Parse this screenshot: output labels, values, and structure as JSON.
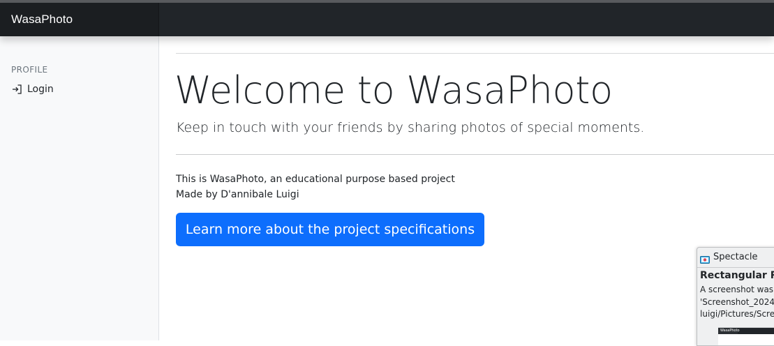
{
  "app": {
    "brand": "WasaPhoto"
  },
  "sidebar": {
    "heading": "PROFILE",
    "items": [
      {
        "label": "Login",
        "icon": "login-icon"
      }
    ]
  },
  "main": {
    "title": "Welcome to WasaPhoto",
    "lead": "Keep in touch with your friends by sharing photos of special moments.",
    "description": [
      "This is WasaPhoto, an educational purpose based project",
      "Made by D'annibale Luigi"
    ],
    "cta_label": "Learn more about the project specifications"
  },
  "notification": {
    "app_name": "Spectacle",
    "title": "Rectangular Re",
    "body_lines": [
      "A screenshot was",
      "'Screenshot_2024",
      "luigi/Pictures/Scre"
    ],
    "thumbnail_brand": "WasaPhoto"
  },
  "colors": {
    "navbar": "#212529",
    "brand_bg": "#1b1e21",
    "sidebar_bg": "#f8f9fa",
    "primary": "#0d6efd",
    "text": "#212529",
    "muted": "#6c757d"
  }
}
